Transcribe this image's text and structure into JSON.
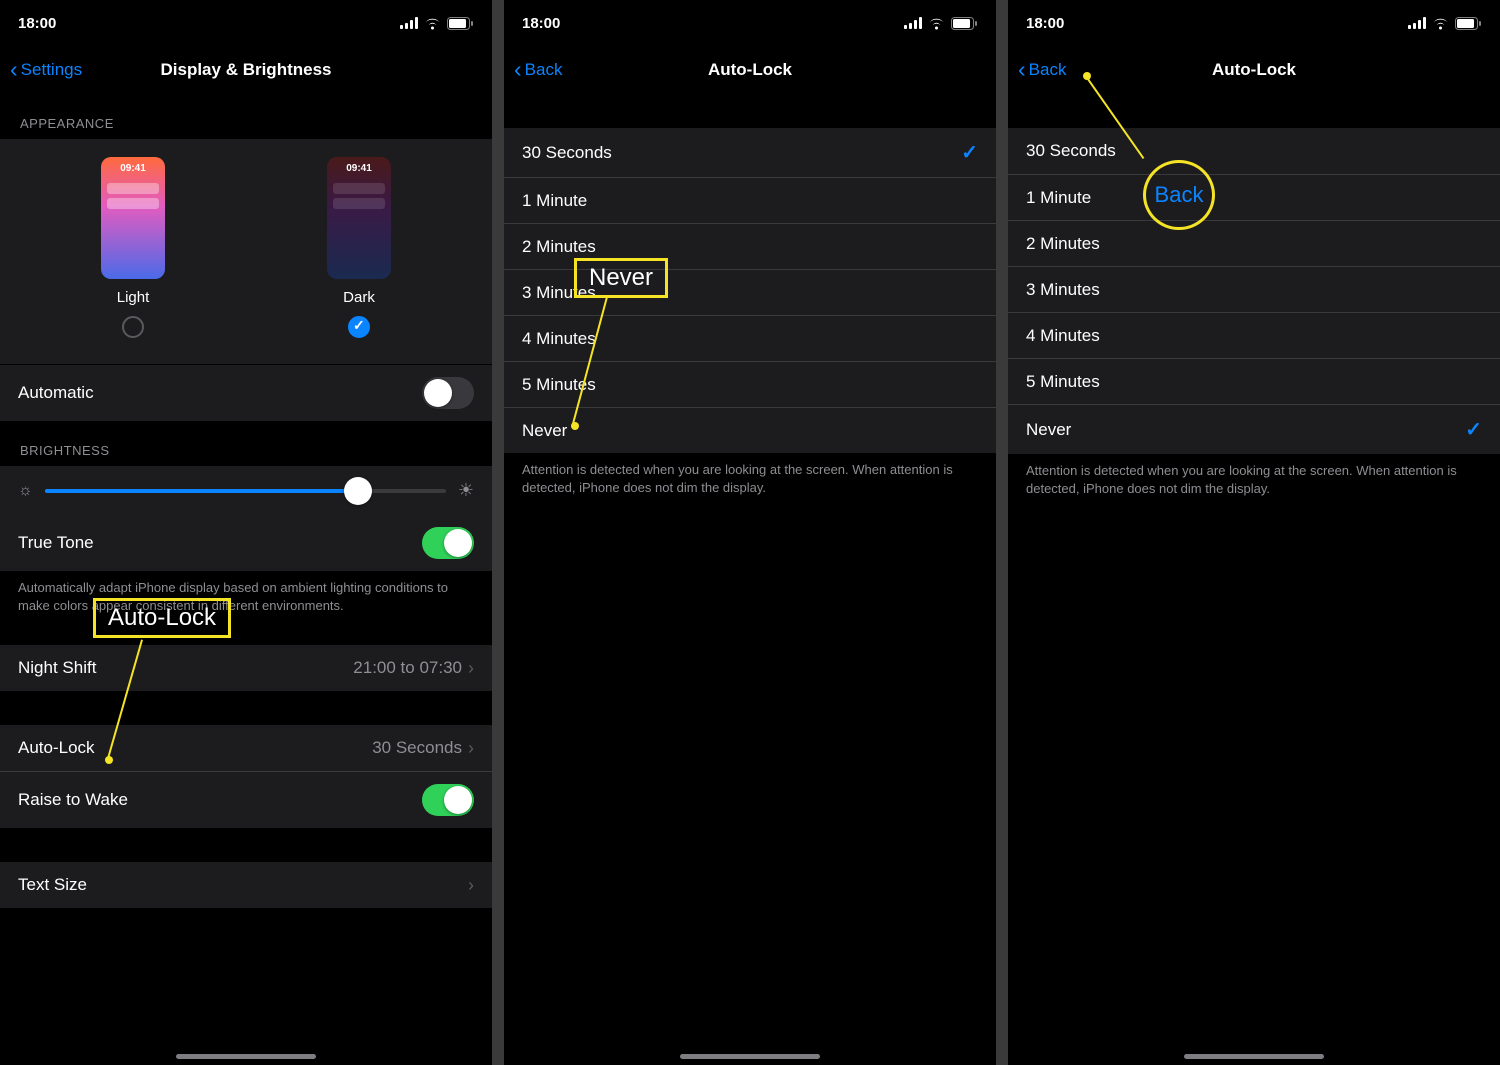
{
  "status": {
    "time": "18:00"
  },
  "panel1": {
    "nav": {
      "back": "Settings",
      "title": "Display & Brightness"
    },
    "appearance_header": "APPEARANCE",
    "theme": {
      "time": "09:41",
      "light": "Light",
      "dark": "Dark"
    },
    "automatic": "Automatic",
    "brightness_header": "BRIGHTNESS",
    "truetone": "True Tone",
    "truetone_footer": "Automatically adapt iPhone display based on ambient lighting conditions to make colors appear consistent in different environments.",
    "nightshift": {
      "label": "Night Shift",
      "detail": "21:00 to 07:30"
    },
    "autolock": {
      "label": "Auto-Lock",
      "detail": "30 Seconds"
    },
    "raise": "Raise to Wake",
    "textsize": "Text Size",
    "callout": "Auto-Lock"
  },
  "autolock_nav": {
    "back": "Back",
    "title": "Auto-Lock"
  },
  "options": {
    "i0": "30 Seconds",
    "i1": "1 Minute",
    "i2": "2 Minutes",
    "i3": "3 Minutes",
    "i4": "4 Minutes",
    "i5": "5 Minutes",
    "i6": "Never"
  },
  "footer": "Attention is detected when you are looking at the screen. When attention is detected, iPhone does not dim the display.",
  "panel2_callout": "Never",
  "panel3_callout": "Back"
}
